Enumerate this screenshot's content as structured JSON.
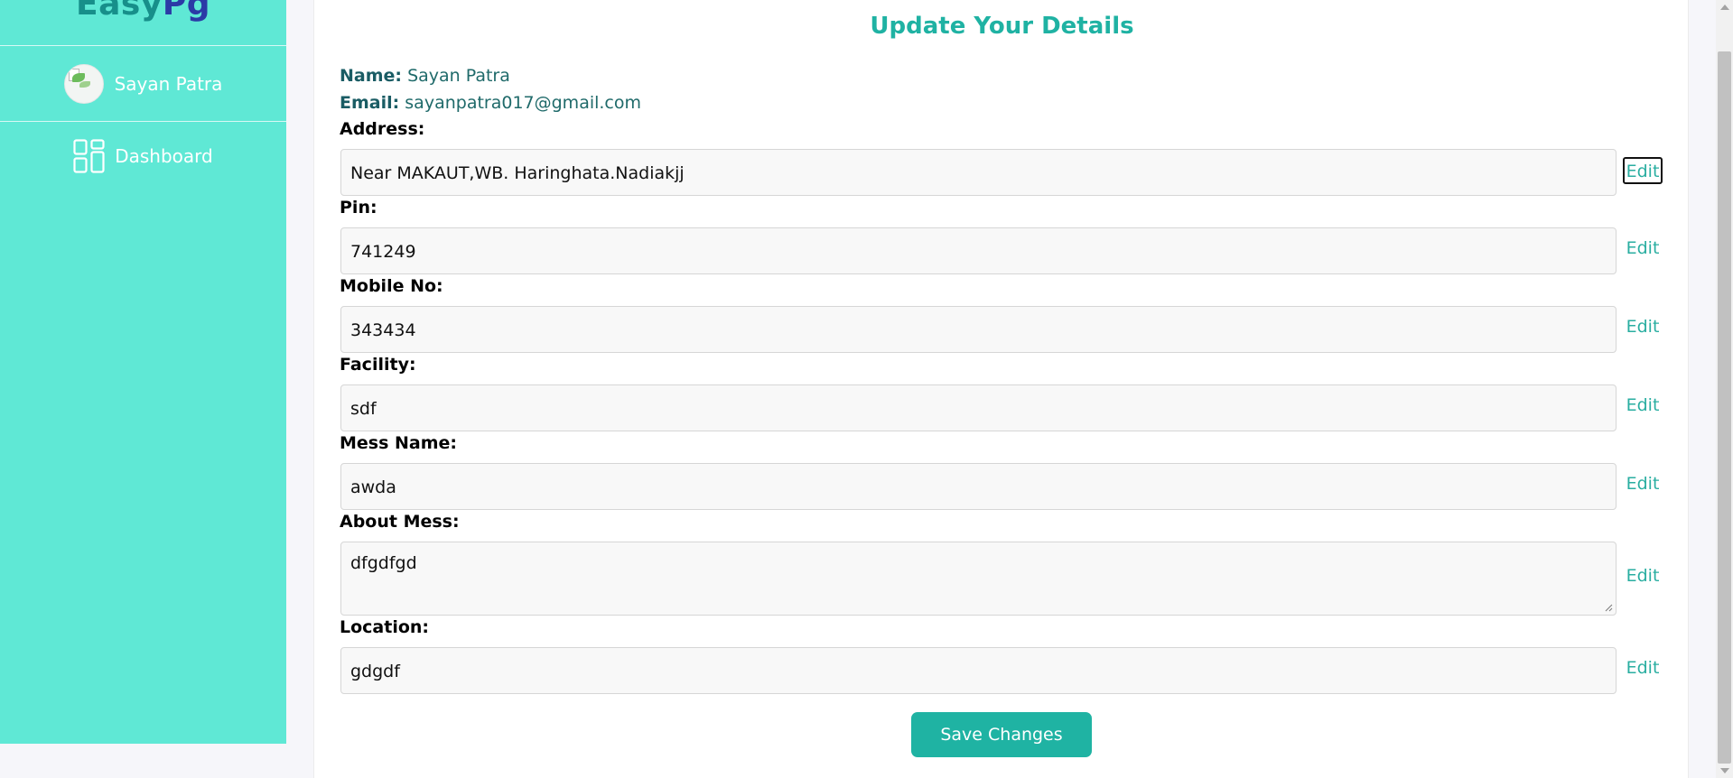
{
  "brand": {
    "part1": "Easy",
    "part2": "Pg"
  },
  "sidebar": {
    "user_name": "Sayan Patra",
    "nav": [
      {
        "label": "Dashboard",
        "icon": "dashboard-icon"
      }
    ]
  },
  "main": {
    "title": "Update Your Details",
    "name_key": "Name:",
    "name_value": "Sayan Patra",
    "email_key": "Email:",
    "email_value": "sayanpatra017@gmail.com",
    "edit_label": "Edit",
    "fields": [
      {
        "label": "Address:",
        "value": "Near MAKAUT,WB. Haringhata.Nadiakjj"
      },
      {
        "label": "Pin:",
        "value": "741249"
      },
      {
        "label": "Mobile No:",
        "value": "343434"
      },
      {
        "label": "Facility:",
        "value": "sdf"
      },
      {
        "label": "Mess Name:",
        "value": "awda"
      },
      {
        "label": "About Mess:",
        "value": "dfgdfgd"
      },
      {
        "label": "Location:",
        "value": "gdgdf"
      }
    ],
    "save_label": "Save Changes"
  },
  "colors": {
    "sidebar_bg": "#5fe8d5",
    "accent": "#1fb2a3",
    "brand_teal": "#178f8a",
    "brand_blue": "#2b3aa6"
  }
}
